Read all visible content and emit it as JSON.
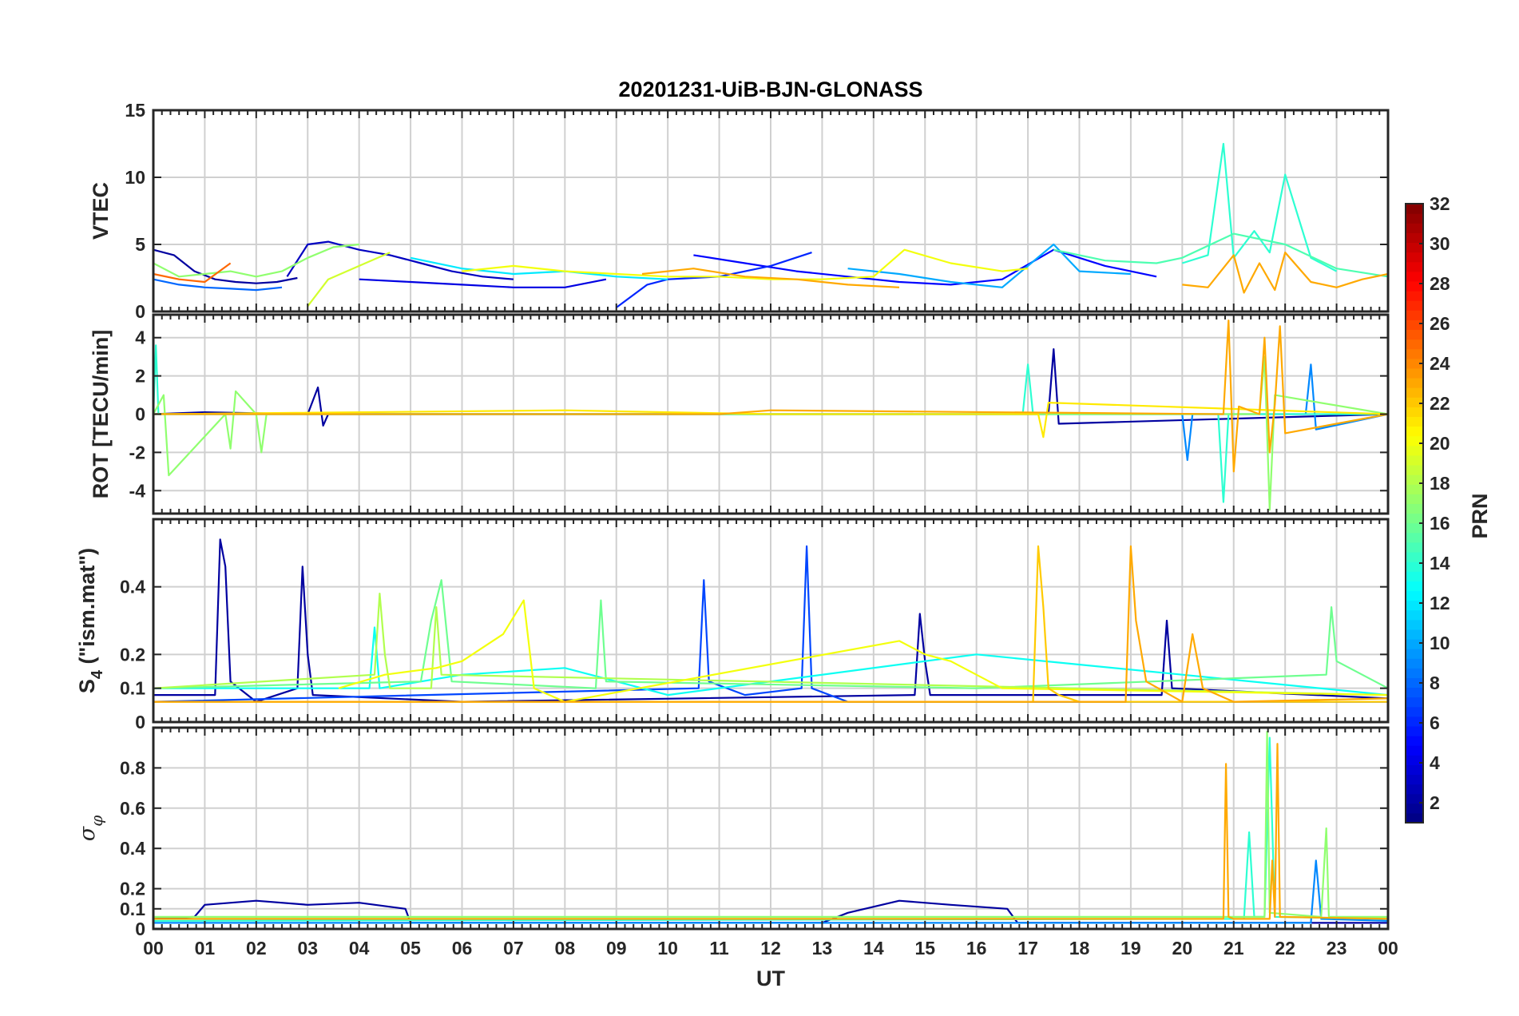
{
  "title": "20201231-UiB-BJN-GLONASS",
  "chart_data": [
    {
      "type": "line",
      "panel": "vtec",
      "ylabel": "VTEC",
      "ylim": [
        0,
        15
      ],
      "yticks": [
        0,
        5,
        10,
        15
      ],
      "ytick_labels": [
        "0",
        "5",
        "10",
        "15"
      ],
      "xlim": [
        0,
        24
      ],
      "grid": true,
      "series": [
        {
          "prn": 2,
          "x": [
            0,
            0.4,
            0.8,
            1.2,
            1.6,
            2.0,
            2.4,
            2.8
          ],
          "y": [
            4.6,
            4.2,
            3.0,
            2.4,
            2.2,
            2.1,
            2.2,
            2.5
          ]
        },
        {
          "prn": 3,
          "x": [
            2.6,
            3.0,
            3.4,
            4.0,
            4.6,
            5.2,
            5.8,
            6.4,
            7.0
          ],
          "y": [
            2.6,
            5.0,
            5.2,
            4.6,
            4.2,
            3.6,
            3.0,
            2.6,
            2.4
          ]
        },
        {
          "prn": 4,
          "x": [
            4.0,
            5.0,
            6.0,
            7.0,
            8.0,
            8.8
          ],
          "y": [
            2.4,
            2.2,
            2.0,
            1.8,
            1.8,
            2.4
          ]
        },
        {
          "prn": 5,
          "x": [
            10.5,
            11.5,
            12.5,
            13.5,
            14.5,
            15.5,
            16.5,
            17.5,
            18.5,
            19.5
          ],
          "y": [
            4.2,
            3.6,
            3.0,
            2.6,
            2.2,
            2.0,
            2.4,
            4.6,
            3.4,
            2.6
          ]
        },
        {
          "prn": 6,
          "x": [
            9.0,
            9.6,
            10.0,
            11.0,
            12.0,
            12.8
          ],
          "y": [
            0.3,
            2.0,
            2.4,
            2.6,
            3.4,
            4.4
          ]
        },
        {
          "prn": 8,
          "x": [
            0,
            0.5,
            1.0,
            1.5,
            2.0,
            2.5
          ],
          "y": [
            2.4,
            2.0,
            1.8,
            1.7,
            1.6,
            1.8
          ]
        },
        {
          "prn": 10,
          "x": [
            13.5,
            14.5,
            15.5,
            16.5,
            17.0,
            17.5,
            18.0,
            19.0
          ],
          "y": [
            3.2,
            2.8,
            2.2,
            1.8,
            3.4,
            5.0,
            3.0,
            2.8
          ]
        },
        {
          "prn": 12,
          "x": [
            5.0,
            6.0,
            7.0,
            8.0,
            9.0,
            10.0
          ],
          "y": [
            4.0,
            3.2,
            2.8,
            3.0,
            2.6,
            2.4
          ]
        },
        {
          "prn": 14,
          "x": [
            20.0,
            20.5,
            20.8,
            21.0,
            21.4,
            21.7,
            22.0,
            22.5,
            23.0
          ],
          "y": [
            3.6,
            4.2,
            12.5,
            4.0,
            6.0,
            4.4,
            10.2,
            4.0,
            3.0
          ]
        },
        {
          "prn": 15,
          "x": [
            17.5,
            18.5,
            19.5,
            20.0,
            21.0,
            22.0,
            23.0,
            24.0
          ],
          "y": [
            4.6,
            3.8,
            3.6,
            4.0,
            5.8,
            5.0,
            3.2,
            2.6
          ]
        },
        {
          "prn": 17,
          "x": [
            0,
            0.5,
            1.0,
            1.5,
            2.0,
            2.5,
            3.0,
            3.5,
            4.0
          ],
          "y": [
            3.6,
            2.6,
            2.8,
            3.0,
            2.6,
            3.0,
            4.0,
            4.8,
            5.0
          ]
        },
        {
          "prn": 19,
          "x": [
            3.0,
            3.4,
            4.0,
            4.6
          ],
          "y": [
            0.4,
            2.4,
            3.4,
            4.4
          ]
        },
        {
          "prn": 20,
          "x": [
            6.0,
            7.0,
            8.0,
            9.0,
            10.0,
            11.0,
            12.0,
            13.0,
            14.0,
            14.6,
            15.5,
            16.5,
            17.0
          ],
          "y": [
            3.0,
            3.4,
            3.0,
            2.8,
            2.6,
            2.6,
            2.4,
            2.4,
            2.6,
            4.6,
            3.6,
            3.0,
            3.2
          ]
        },
        {
          "prn": 23,
          "x": [
            9.5,
            10.5,
            11.5,
            12.5,
            13.5,
            14.5
          ],
          "y": [
            2.8,
            3.2,
            2.6,
            2.4,
            2.0,
            1.8
          ]
        },
        {
          "prn": 23,
          "x": [
            20.0,
            20.5,
            21.0,
            21.2,
            21.5,
            21.8,
            22.0,
            22.5,
            23.0,
            23.5,
            24.0
          ],
          "y": [
            2.0,
            1.8,
            4.2,
            1.4,
            3.6,
            1.6,
            4.4,
            2.2,
            1.8,
            2.4,
            2.8
          ]
        },
        {
          "prn": 25,
          "x": [
            0,
            0.5,
            1.0,
            1.5
          ],
          "y": [
            2.8,
            2.4,
            2.2,
            3.6
          ]
        }
      ]
    },
    {
      "type": "line",
      "panel": "rot",
      "ylabel": "ROT [TECU/min]",
      "ylim": [
        -5.2,
        5.2
      ],
      "yticks": [
        -4,
        -2,
        0,
        2,
        4
      ],
      "ytick_labels": [
        "-4",
        "-2",
        "0",
        "2",
        "4"
      ],
      "xlim": [
        0,
        24
      ],
      "grid": true,
      "series": [
        {
          "prn": 2,
          "x": [
            0,
            1.0,
            3.0,
            3.2,
            3.3,
            3.4,
            6.0,
            12.0,
            17.4,
            17.5,
            17.6,
            24.0
          ],
          "y": [
            0,
            0.1,
            0,
            1.4,
            -0.6,
            0,
            0,
            0,
            0,
            3.4,
            -0.5,
            0
          ]
        },
        {
          "prn": 9,
          "x": [
            0,
            20.0,
            20.1,
            20.2,
            22.4,
            22.5,
            22.6,
            24.0
          ],
          "y": [
            0,
            0,
            -2.4,
            0,
            0,
            2.6,
            -0.8,
            0
          ]
        },
        {
          "prn": 14,
          "x": [
            0,
            0.05,
            0.1,
            16.9,
            17.0,
            17.1,
            20.7,
            20.8,
            20.9,
            21.0,
            24.0
          ],
          "y": [
            0,
            3.6,
            0,
            0,
            2.6,
            0,
            0,
            -4.6,
            0,
            0,
            0
          ]
        },
        {
          "prn": 17,
          "x": [
            0,
            0.2,
            0.3,
            1.4,
            1.5,
            1.6,
            2.0,
            2.1,
            2.2,
            21.5,
            21.6,
            21.7,
            21.8,
            24.0
          ],
          "y": [
            0,
            1.0,
            -3.2,
            0,
            -1.8,
            1.2,
            0,
            -2.0,
            0,
            0,
            3.0,
            -5.0,
            1.0,
            0
          ]
        },
        {
          "prn": 21,
          "x": [
            0,
            8.0,
            12.0,
            15.0,
            17.2,
            17.3,
            17.4,
            24.0
          ],
          "y": [
            0,
            0.2,
            0,
            0,
            0,
            -1.2,
            0.6,
            0
          ]
        },
        {
          "prn": 23,
          "x": [
            0,
            11.0,
            12.0,
            20.8,
            20.9,
            21.0,
            21.1,
            21.5,
            21.6,
            21.7,
            21.8,
            21.9,
            22.0,
            24.0
          ],
          "y": [
            0,
            0,
            0.2,
            0,
            4.9,
            -3.0,
            0.4,
            0,
            4.0,
            -2.0,
            0.5,
            4.6,
            -1.0,
            0
          ]
        }
      ]
    },
    {
      "type": "line",
      "panel": "s4",
      "ylabel": "S4 (\"ism.mat\")",
      "ylim": [
        0,
        0.6
      ],
      "yticks": [
        0,
        0.1,
        0.2,
        0.4
      ],
      "ytick_labels": [
        "0",
        "0.1",
        "0.2",
        "0.4"
      ],
      "xlim": [
        0,
        24
      ],
      "grid": true,
      "series": [
        {
          "prn": 2,
          "x": [
            0,
            1.2,
            1.3,
            1.4,
            1.5,
            2.0,
            2.8,
            2.9,
            3.0,
            3.1,
            6.0,
            14.8,
            14.9,
            15.0,
            15.1,
            19.6,
            19.7,
            19.8,
            24.0
          ],
          "y": [
            0.08,
            0.08,
            0.54,
            0.46,
            0.12,
            0.06,
            0.1,
            0.46,
            0.2,
            0.08,
            0.06,
            0.08,
            0.32,
            0.18,
            0.08,
            0.08,
            0.3,
            0.1,
            0.07
          ]
        },
        {
          "prn": 7,
          "x": [
            0,
            10.6,
            10.7,
            10.8,
            11.5,
            12.6,
            12.7,
            12.8,
            13.5,
            24.0
          ],
          "y": [
            0.06,
            0.1,
            0.42,
            0.12,
            0.08,
            0.1,
            0.52,
            0.1,
            0.06,
            0.06
          ]
        },
        {
          "prn": 13,
          "x": [
            0,
            4.2,
            4.3,
            4.4,
            6.0,
            8.0,
            10.0,
            16.0,
            20.0,
            24.0
          ],
          "y": [
            0.1,
            0.1,
            0.28,
            0.1,
            0.14,
            0.16,
            0.08,
            0.2,
            0.14,
            0.08
          ]
        },
        {
          "prn": 16,
          "x": [
            0,
            5.2,
            5.4,
            5.6,
            5.8,
            8.6,
            8.7,
            8.8,
            16.0,
            22.8,
            22.9,
            23.0,
            24.0
          ],
          "y": [
            0.1,
            0.12,
            0.3,
            0.42,
            0.12,
            0.1,
            0.36,
            0.12,
            0.1,
            0.14,
            0.34,
            0.18,
            0.1
          ]
        },
        {
          "prn": 18,
          "x": [
            0,
            4.3,
            4.4,
            4.5,
            4.6,
            5.4,
            5.5,
            5.6,
            24.0
          ],
          "y": [
            0.1,
            0.14,
            0.38,
            0.2,
            0.1,
            0.1,
            0.34,
            0.14,
            0.08
          ]
        },
        {
          "prn": 20,
          "x": [
            3.6,
            4.5,
            5.5,
            6.0,
            6.8,
            7.2,
            7.4,
            8.0,
            14.5,
            15.0,
            15.5,
            16.5,
            24.0
          ],
          "y": [
            0.1,
            0.14,
            0.16,
            0.18,
            0.26,
            0.36,
            0.1,
            0.06,
            0.24,
            0.2,
            0.18,
            0.1,
            0.08
          ]
        },
        {
          "prn": 22,
          "x": [
            0,
            17.1,
            17.2,
            17.3,
            17.4,
            17.6,
            18.0,
            24.0
          ],
          "y": [
            0.06,
            0.06,
            0.52,
            0.34,
            0.1,
            0.08,
            0.06,
            0.06
          ]
        },
        {
          "prn": 23,
          "x": [
            0,
            18.9,
            19.0,
            19.1,
            19.3,
            20.0,
            20.2,
            20.4,
            21.0,
            24.0
          ],
          "y": [
            0.06,
            0.06,
            0.52,
            0.3,
            0.12,
            0.06,
            0.26,
            0.1,
            0.06,
            0.07
          ]
        }
      ]
    },
    {
      "type": "line",
      "panel": "sigma_phi",
      "ylabel": "σφ",
      "ylim": [
        0,
        1.0
      ],
      "yticks": [
        0,
        0.1,
        0.2,
        0.4,
        0.6,
        0.8
      ],
      "ytick_labels": [
        "0",
        "0.1",
        "0.2",
        "0.4",
        "0.6",
        "0.8"
      ],
      "xlim": [
        0,
        24
      ],
      "grid": true,
      "series": [
        {
          "prn": 2,
          "x": [
            0,
            0.8,
            1.0,
            2.0,
            3.0,
            4.0,
            4.9,
            5.0,
            13.0,
            13.5,
            14.5,
            15.5,
            16.6,
            16.8,
            24.0
          ],
          "y": [
            0.05,
            0.06,
            0.12,
            0.14,
            0.12,
            0.13,
            0.1,
            0.03,
            0.03,
            0.08,
            0.14,
            0.12,
            0.1,
            0.03,
            0.03
          ]
        },
        {
          "prn": 9,
          "x": [
            0,
            22.5,
            22.6,
            22.7,
            24.0
          ],
          "y": [
            0.03,
            0.03,
            0.34,
            0.05,
            0.04
          ]
        },
        {
          "prn": 14,
          "x": [
            0,
            21.2,
            21.3,
            21.4,
            21.6,
            21.7,
            21.8,
            24.0
          ],
          "y": [
            0.04,
            0.05,
            0.48,
            0.06,
            0.06,
            0.95,
            0.06,
            0.05
          ]
        },
        {
          "prn": 17,
          "x": [
            0,
            21.6,
            21.65,
            21.7,
            22.7,
            22.8,
            22.85,
            24.0
          ],
          "y": [
            0.06,
            0.06,
            0.98,
            0.08,
            0.06,
            0.5,
            0.06,
            0.06
          ]
        },
        {
          "prn": 23,
          "x": [
            0,
            20.8,
            20.85,
            20.9,
            21.0,
            21.7,
            21.75,
            21.8,
            21.85,
            21.9,
            24.0
          ],
          "y": [
            0.05,
            0.05,
            0.82,
            0.06,
            0.05,
            0.05,
            0.34,
            0.06,
            0.92,
            0.06,
            0.05
          ]
        }
      ]
    }
  ],
  "xaxis": {
    "label": "UT",
    "tick_labels": [
      "00",
      "01",
      "02",
      "03",
      "04",
      "05",
      "06",
      "07",
      "08",
      "09",
      "10",
      "11",
      "12",
      "13",
      "14",
      "15",
      "16",
      "17",
      "18",
      "19",
      "20",
      "21",
      "22",
      "23",
      "00"
    ]
  },
  "colorbar": {
    "label": "PRN",
    "colormap": "jet",
    "range": [
      1,
      32
    ],
    "ticks": [
      2,
      4,
      6,
      8,
      10,
      12,
      14,
      16,
      18,
      20,
      22,
      24,
      26,
      28,
      30,
      32
    ],
    "tick_labels": [
      "2",
      "4",
      "6",
      "8",
      "10",
      "12",
      "14",
      "16",
      "18",
      "20",
      "22",
      "24",
      "26",
      "28",
      "30",
      "32"
    ]
  }
}
